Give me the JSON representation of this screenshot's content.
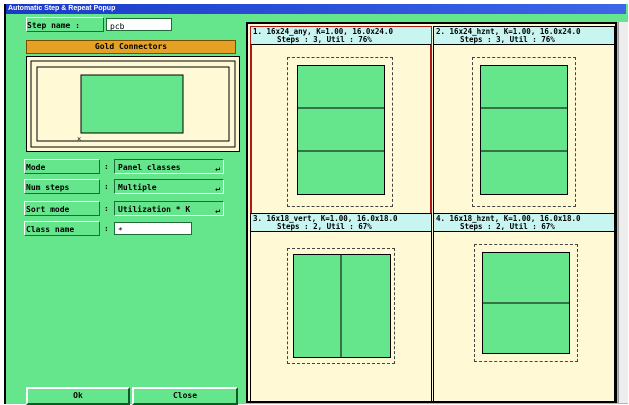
{
  "window": {
    "title": "Automatic Step & Repeat Popup"
  },
  "step": {
    "label": "Step name :",
    "value": "pcb"
  },
  "material": "Gold Connectors",
  "fields": [
    {
      "label": "Mode",
      "sep": ":",
      "value": "Panel classes",
      "arrow": "↵"
    },
    {
      "label": "Num steps",
      "sep": ":",
      "value": "Multiple",
      "arrow": "↵"
    },
    {
      "label": "Sort mode",
      "sep": ":",
      "value": "Utilization * K",
      "arrow": "↵"
    },
    {
      "label": "Class name",
      "sep": ":",
      "value": "*"
    }
  ],
  "buttons": {
    "ok": "Ok",
    "close": "Close"
  },
  "results": [
    {
      "line1": "1. 16x24_any, K=1.00, 16.0x24.0",
      "line2": "Steps : 3, Util : 76%",
      "steps": 3,
      "orientation": "v"
    },
    {
      "line1": "2. 16x24_hznt, K=1.00, 16.0x24.0",
      "line2": "Steps : 3, Util : 76%",
      "steps": 3,
      "orientation": "v"
    },
    {
      "line1": "3. 16x18_vert, K=1.00, 16.0x18.0",
      "line2": "Steps : 2, Util : 67%",
      "steps": 2,
      "orientation": "h"
    },
    {
      "line1": "4. 16x18_hznt, K=1.00, 16.0x18.0",
      "line2": "Steps : 2, Util : 67%",
      "steps": 2,
      "orientation": "v"
    }
  ]
}
